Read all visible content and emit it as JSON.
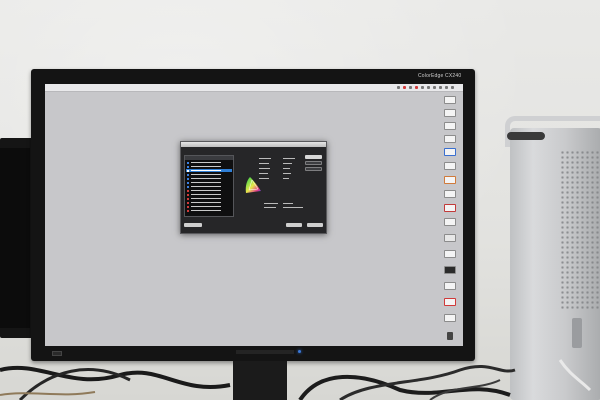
{
  "monitor": {
    "brand_label": "ColorEdge CX240"
  },
  "screen": {
    "menubar_text": ""
  },
  "dialog": {
    "title": ""
  },
  "colors": {
    "screen_background": "#c7c7ca",
    "dialog_background": "#262628",
    "selection_blue": "#2f7fd6",
    "power_led": "#3a78d8"
  },
  "icons": {
    "dock": "app-dock-icon",
    "gamut": "color-gamut-diagram-icon"
  }
}
